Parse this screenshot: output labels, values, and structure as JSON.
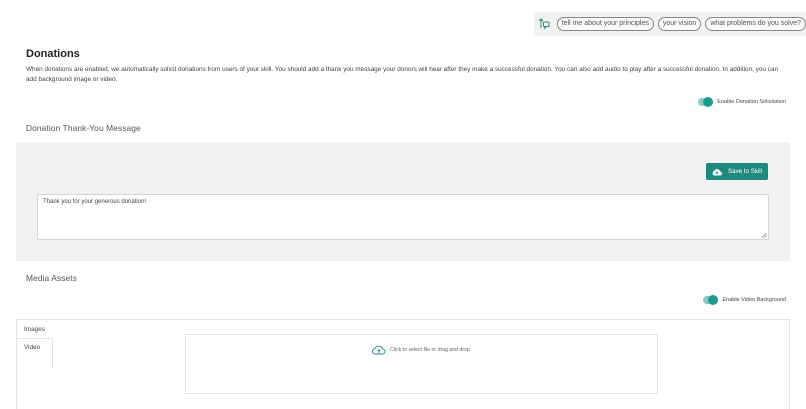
{
  "prompts": {
    "chips": [
      "tell me about your principles",
      "your vision",
      "what problems do you solve?"
    ]
  },
  "donations": {
    "title": "Donations",
    "description": "When donations are enabled, we automatically solicit donations from users of your skill. You should add a thank you message your donors will hear after they make a successful donation. You can also add audio to play after a successful donation. In addition, you can add background image or video.",
    "toggle_label": "Enable Donation Solicitation",
    "toggle_on": true
  },
  "thank_you": {
    "title": "Donation Thank-You Message",
    "save_label": "Save to Skill",
    "message": "Thank you for your generous donation!"
  },
  "media": {
    "title": "Media Assets",
    "toggle_label": "Enable Video Background",
    "toggle_on": true,
    "tabs": [
      "Images",
      "Video"
    ],
    "dropzone_text": "Click to select file or drag and drop"
  },
  "colors": {
    "accent": "#1d8a80",
    "toggle_track": "#8cc9c3",
    "panel_bg": "#f2f2f2"
  }
}
